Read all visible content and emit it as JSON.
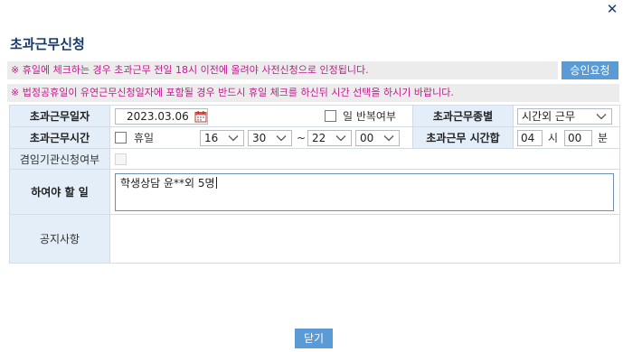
{
  "dialog": {
    "close_icon": "close-icon",
    "title": "초과근무신청",
    "notice1": "※ 휴일에 체크하는 경우 초과근무 전일 18시 이전에 올려야 사전신청으로 인정됩니다.",
    "notice2": "※ 법정공휴일이 유연근무신청일자에 포함될 경우 반드시 휴일 체크를 하신뒤 시간 선택을 하시기 바랍니다.",
    "approve_button": "승인요청",
    "close_button": "닫기"
  },
  "form": {
    "work_date_label": "초과근무일자",
    "work_date_value": "2023.03.06",
    "calendar_icon": "calendar-icon",
    "repeat_label": "일 반복여부",
    "repeat_checked": false,
    "work_type_label": "초과근무종별",
    "work_type_value": "시간외 근무",
    "work_time_label": "초과근무시간",
    "holiday_label": "휴일",
    "holiday_checked": false,
    "start_hour": "16",
    "start_minute": "30",
    "time_separator": "~",
    "end_hour": "22",
    "end_minute": "00",
    "total_label": "초과근무 시간합",
    "total_hours": "04",
    "hours_unit": "시",
    "total_minutes": "00",
    "minutes_unit": "분",
    "concurrent_label": "겸임기관신청여부",
    "concurrent_checked": false,
    "todo_label": "하여야 할 일",
    "todo_value": "학생상담 윤**외 5명",
    "notice_label": "공지사항",
    "notice_value": ""
  }
}
